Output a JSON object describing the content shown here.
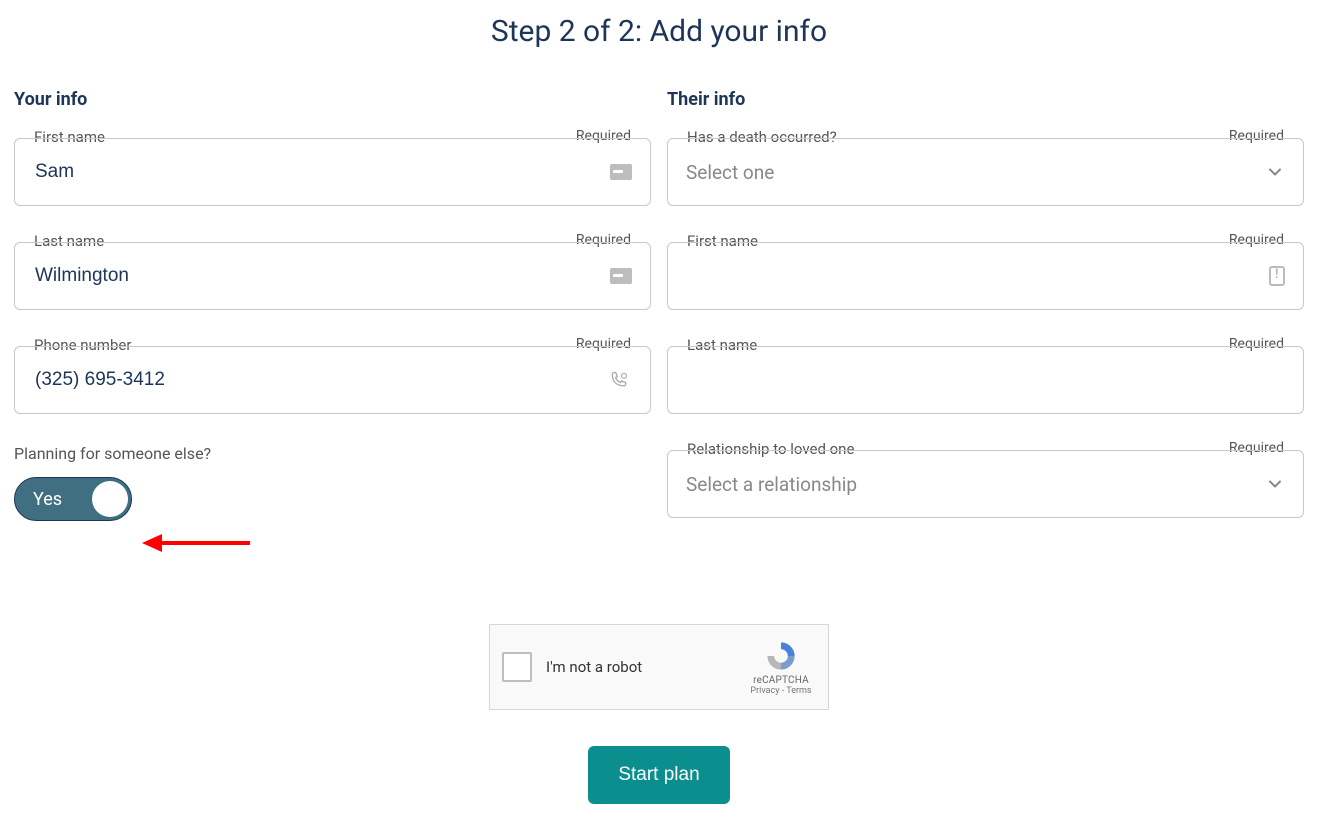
{
  "title": "Step 2 of 2: Add your info",
  "your_info": {
    "heading": "Your info",
    "first_name": {
      "label": "First name",
      "required": "Required",
      "value": "Sam"
    },
    "last_name": {
      "label": "Last name",
      "required": "Required",
      "value": "Wilmington"
    },
    "phone": {
      "label": "Phone number",
      "required": "Required",
      "value": "(325) 695-3412"
    },
    "planning_question": "Planning for someone else?",
    "toggle_label": "Yes"
  },
  "their_info": {
    "heading": "Their info",
    "death": {
      "label": "Has a death occurred?",
      "required": "Required",
      "placeholder": "Select one"
    },
    "first_name": {
      "label": "First name",
      "required": "Required",
      "value": ""
    },
    "last_name": {
      "label": "Last name",
      "required": "Required",
      "value": ""
    },
    "relationship": {
      "label": "Relationship to loved one",
      "required": "Required",
      "placeholder": "Select a relationship"
    }
  },
  "captcha": {
    "text": "I'm not a robot",
    "brand": "reCAPTCHA",
    "links": "Privacy - Terms"
  },
  "submit_label": "Start plan"
}
